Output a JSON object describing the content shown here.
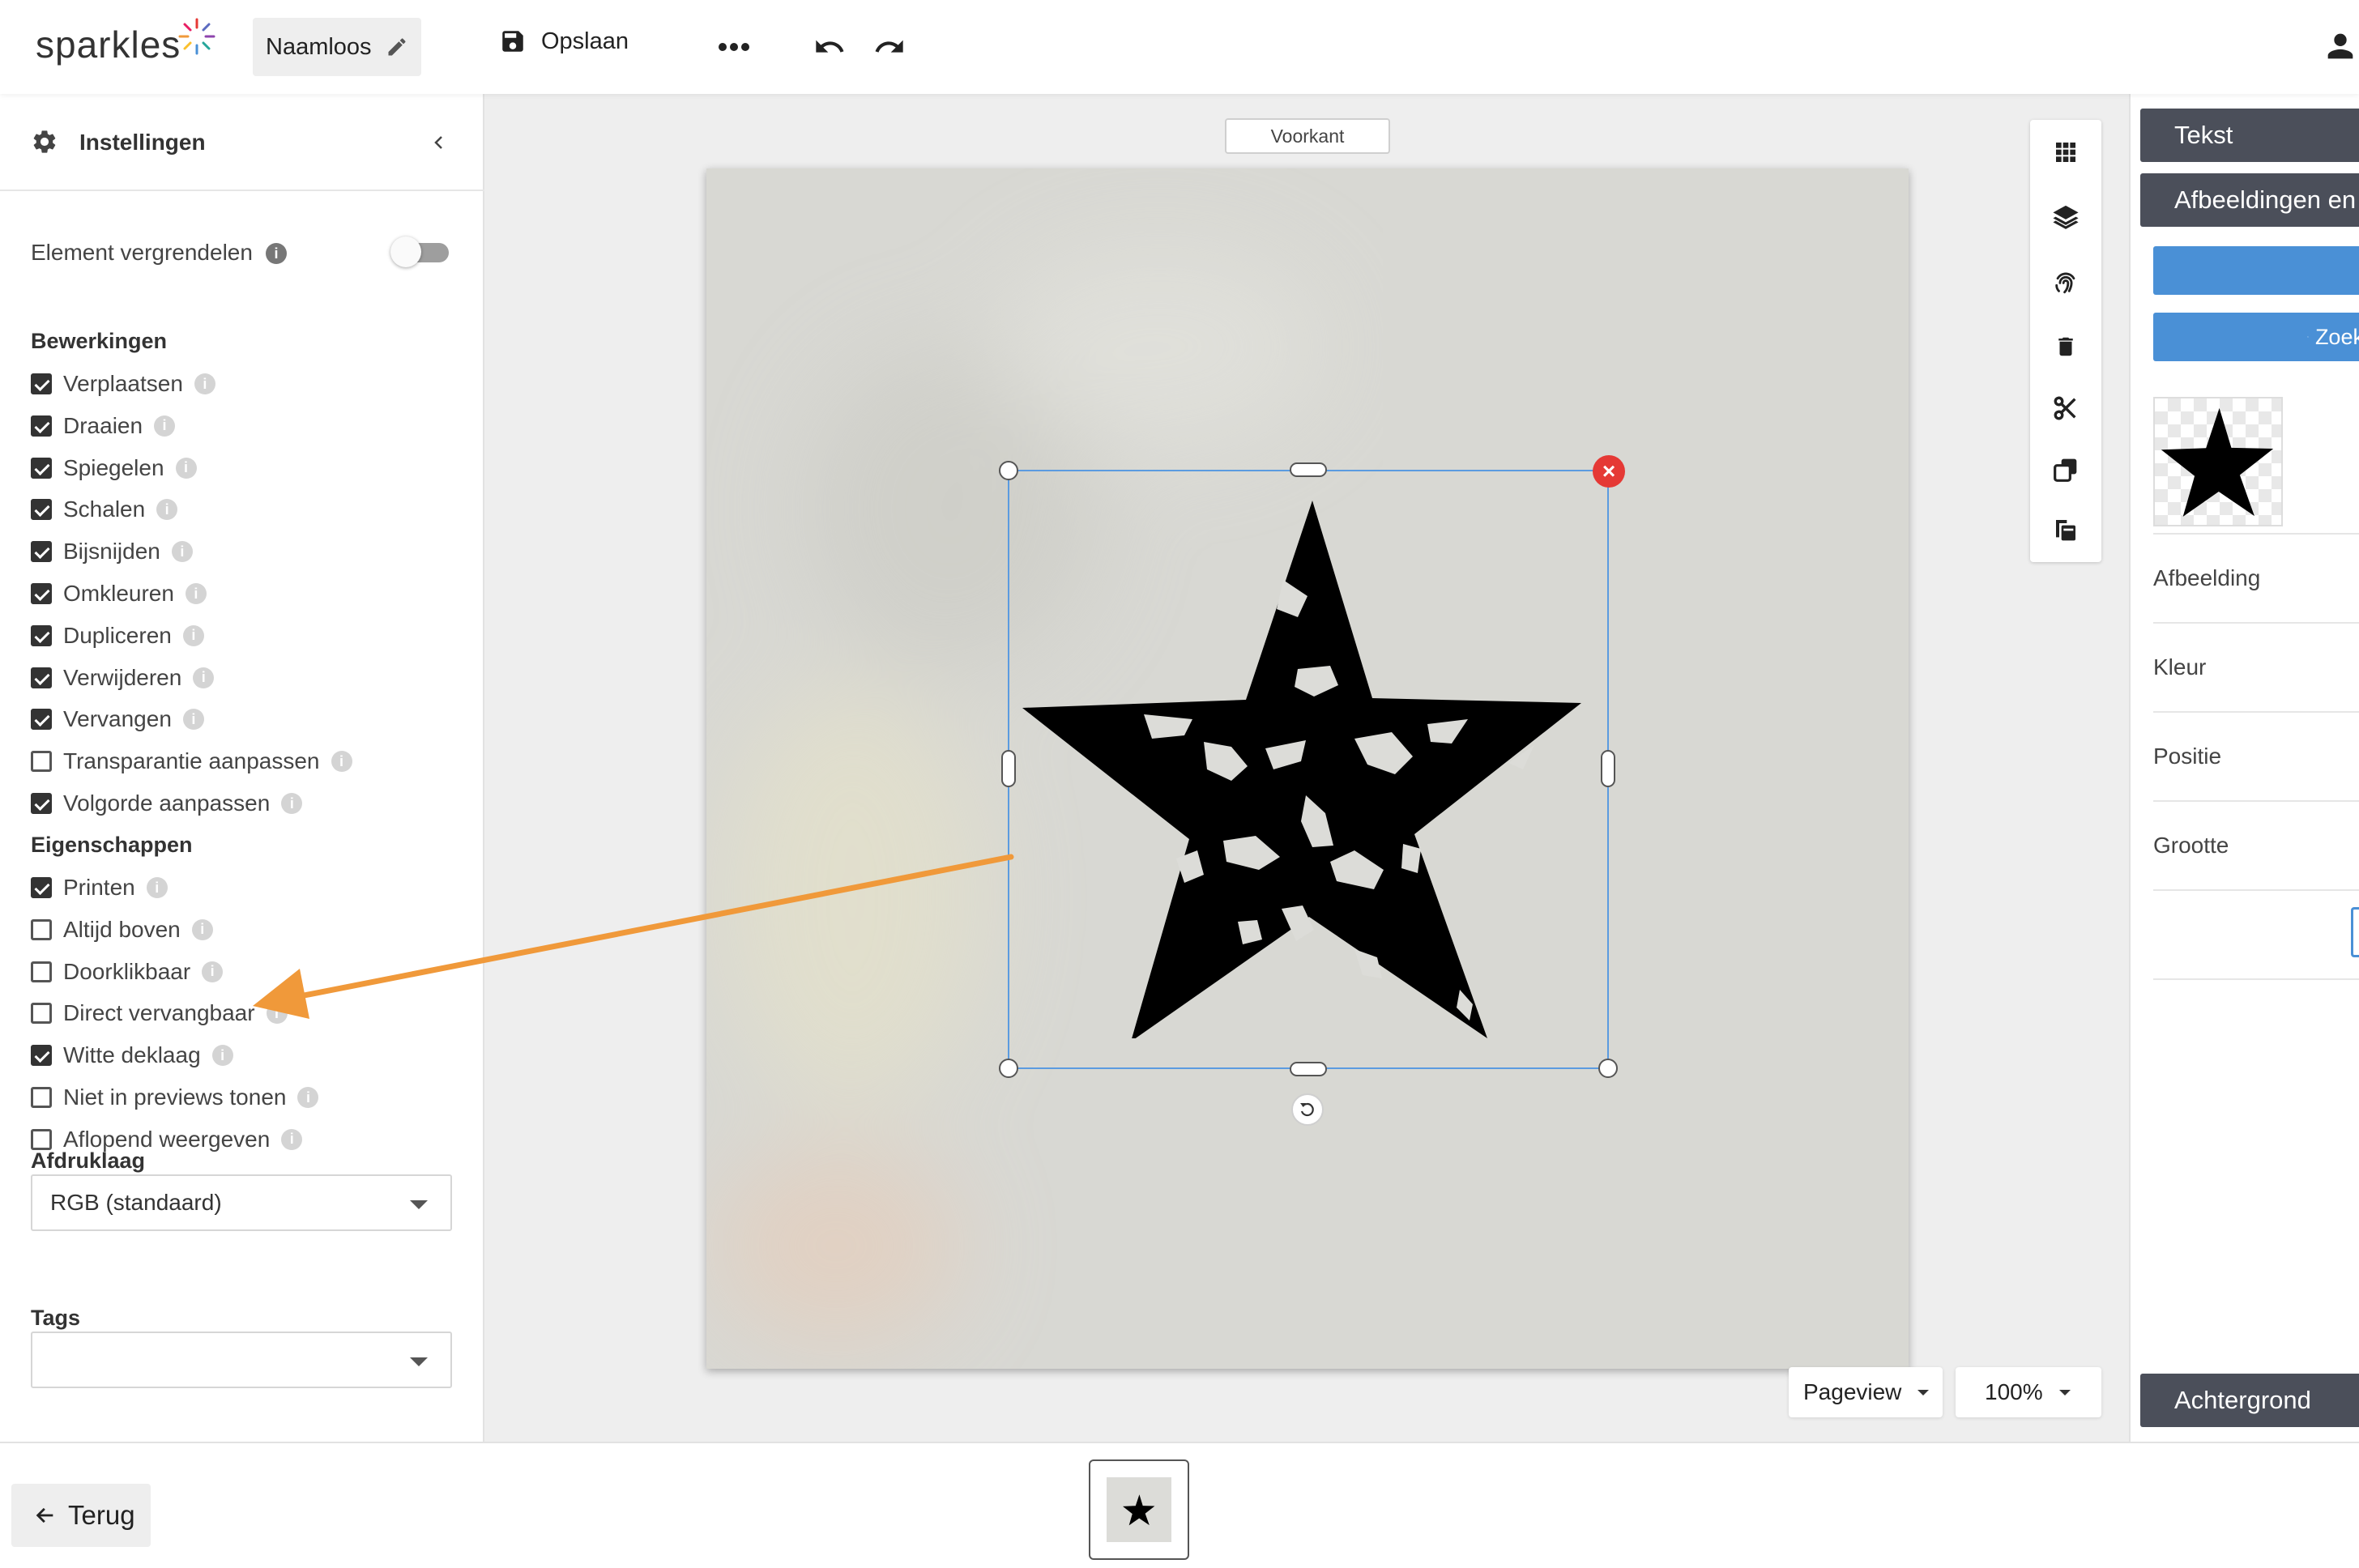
{
  "app": {
    "logo_text": "sparkles"
  },
  "header": {
    "document_name": "Naamloos",
    "save_label": "Opslaan"
  },
  "left_panel": {
    "title": "Instellingen",
    "lock_label": "Element vergrendelen",
    "lock_enabled": false,
    "sections": {
      "bewerkingen": {
        "title": "Bewerkingen",
        "items": [
          {
            "label": "Verplaatsen",
            "checked": true
          },
          {
            "label": "Draaien",
            "checked": true
          },
          {
            "label": "Spiegelen",
            "checked": true
          },
          {
            "label": "Schalen",
            "checked": true
          },
          {
            "label": "Bijsnijden",
            "checked": true
          },
          {
            "label": "Omkleuren",
            "checked": true
          },
          {
            "label": "Dupliceren",
            "checked": true
          },
          {
            "label": "Verwijderen",
            "checked": true
          },
          {
            "label": "Vervangen",
            "checked": true
          },
          {
            "label": "Transparantie aanpassen",
            "checked": false
          },
          {
            "label": "Volgorde aanpassen",
            "checked": true
          }
        ]
      },
      "eigenschappen": {
        "title": "Eigenschappen",
        "items": [
          {
            "label": "Printen",
            "checked": true
          },
          {
            "label": "Altijd boven",
            "checked": false
          },
          {
            "label": "Doorklikbaar",
            "checked": false
          },
          {
            "label": "Direct vervangbaar",
            "checked": false
          },
          {
            "label": "Witte deklaag",
            "checked": true
          },
          {
            "label": "Niet in previews tonen",
            "checked": false
          },
          {
            "label": "Aflopend weergeven",
            "checked": false
          }
        ]
      }
    },
    "afdruklaag": {
      "title": "Afdruklaag",
      "value": "RGB (standaard)"
    },
    "tags": {
      "title": "Tags",
      "value": ""
    }
  },
  "canvas": {
    "side_label": "Voorkant",
    "pageview_label": "Pageview",
    "zoom_label": "100%"
  },
  "right_panel": {
    "tabs": [
      "Tekst",
      "Afbeeldingen en vormen"
    ],
    "search_label": "Zoeken",
    "property_rows": [
      "Afbeelding",
      "Kleur",
      "Positie",
      "Grootte"
    ],
    "background_tab": "Achtergrond"
  },
  "footer": {
    "back_label": "Terug"
  },
  "colors": {
    "accent_blue": "#4a90d6",
    "dark_tab": "#4b4f5a",
    "delete_red": "#e53935",
    "annotation_orange": "#f0993a",
    "selection_blue": "#5b9be0"
  },
  "icons": {
    "logo_spark": "sparkle-icon",
    "edit": "pencil-icon",
    "save": "floppy-disk-icon",
    "more": "more-horizontal-icon",
    "undo": "undo-icon",
    "redo": "redo-icon",
    "user": "user-icon",
    "settings": "gear-icon",
    "collapse": "chevron-left-icon",
    "toolbar": [
      "grid-icon",
      "layers-icon",
      "fingerprint-icon",
      "trash-icon",
      "scissors-icon",
      "duplicate-icon",
      "paste-icon"
    ],
    "back": "arrow-left-icon"
  }
}
